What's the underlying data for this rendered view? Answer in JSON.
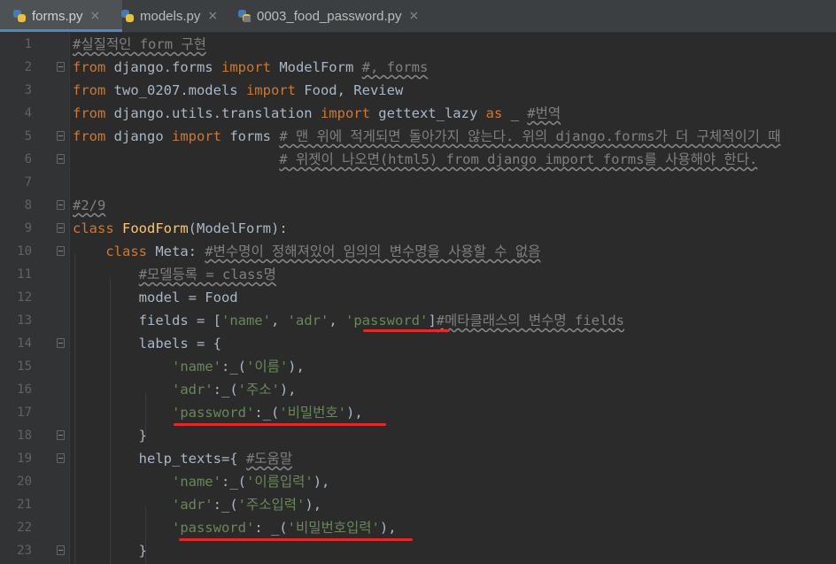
{
  "tabs": [
    {
      "label": "forms.py",
      "active": true
    },
    {
      "label": "models.py",
      "active": false
    },
    {
      "label": "0003_food_password.py",
      "active": false
    }
  ],
  "close_glyph": "×",
  "lines": [
    {
      "n": "1",
      "parts": [
        {
          "t": "#실질적인 form 구현",
          "c": "cmt"
        }
      ]
    },
    {
      "n": "2",
      "parts": [
        {
          "t": "from",
          "c": "kw"
        },
        {
          "t": " django.forms "
        },
        {
          "t": "import",
          "c": "kw"
        },
        {
          "t": " ModelForm "
        },
        {
          "t": "#, forms",
          "c": "cmt"
        }
      ]
    },
    {
      "n": "3",
      "parts": [
        {
          "t": "from",
          "c": "kw"
        },
        {
          "t": " two_0207.models "
        },
        {
          "t": "import",
          "c": "kw"
        },
        {
          "t": " Food, Review"
        }
      ]
    },
    {
      "n": "4",
      "parts": [
        {
          "t": "from",
          "c": "kw"
        },
        {
          "t": " django.utils.translation "
        },
        {
          "t": "import",
          "c": "kw"
        },
        {
          "t": " gettext_lazy "
        },
        {
          "t": "as",
          "c": "kw"
        },
        {
          "t": " _ "
        },
        {
          "t": "#번역",
          "c": "cmt"
        }
      ]
    },
    {
      "n": "5",
      "parts": [
        {
          "t": "from",
          "c": "kw"
        },
        {
          "t": " django "
        },
        {
          "t": "import",
          "c": "kw"
        },
        {
          "t": " forms "
        },
        {
          "t": "# 맨 위에 적게되면 돌아가지 않는다. 위의 django.forms가 더 구체적이기 때",
          "c": "cmt"
        }
      ]
    },
    {
      "n": "6",
      "parts": [
        {
          "t": "                         "
        },
        {
          "t": "# 위젯이 나오면(html5) from django import forms를 사용해야 한다.",
          "c": "cmt"
        }
      ]
    },
    {
      "n": "7",
      "parts": []
    },
    {
      "n": "8",
      "parts": [
        {
          "t": "#2/9",
          "c": "cmt"
        }
      ]
    },
    {
      "n": "9",
      "parts": [
        {
          "t": "class",
          "c": "kw"
        },
        {
          "t": " "
        },
        {
          "t": "FoodForm",
          "c": "cls"
        },
        {
          "t": "(ModelForm):"
        }
      ]
    },
    {
      "n": "10",
      "parts": [
        {
          "t": "    "
        },
        {
          "t": "class",
          "c": "kw"
        },
        {
          "t": " Meta: "
        },
        {
          "t": "#변수명이 정해져있어 임의의 변수명을 사용할 수 없음",
          "c": "cmt"
        }
      ]
    },
    {
      "n": "11",
      "parts": [
        {
          "t": "        "
        },
        {
          "t": "#모델등록 = class명",
          "c": "cmt"
        }
      ]
    },
    {
      "n": "12",
      "parts": [
        {
          "t": "        model = Food"
        }
      ]
    },
    {
      "n": "13",
      "parts": [
        {
          "t": "        fields = ["
        },
        {
          "t": "'name'",
          "c": "str"
        },
        {
          "t": ", "
        },
        {
          "t": "'adr'",
          "c": "str"
        },
        {
          "t": ", "
        },
        {
          "t": "'password'",
          "c": "str"
        },
        {
          "t": "]"
        },
        {
          "t": "#메타클래스의 변수명 fields",
          "c": "cmt"
        }
      ]
    },
    {
      "n": "14",
      "parts": [
        {
          "t": "        labels = {"
        }
      ]
    },
    {
      "n": "15",
      "parts": [
        {
          "t": "            "
        },
        {
          "t": "'name'",
          "c": "str"
        },
        {
          "t": ":_("
        },
        {
          "t": "'이름'",
          "c": "str"
        },
        {
          "t": "),"
        }
      ]
    },
    {
      "n": "16",
      "parts": [
        {
          "t": "            "
        },
        {
          "t": "'adr'",
          "c": "str"
        },
        {
          "t": ":_("
        },
        {
          "t": "'주소'",
          "c": "str"
        },
        {
          "t": "),"
        }
      ]
    },
    {
      "n": "17",
      "parts": [
        {
          "t": "            "
        },
        {
          "t": "'password'",
          "c": "str"
        },
        {
          "t": ":_("
        },
        {
          "t": "'비밀번호'",
          "c": "str"
        },
        {
          "t": "),"
        }
      ]
    },
    {
      "n": "18",
      "parts": [
        {
          "t": "        }"
        }
      ]
    },
    {
      "n": "19",
      "parts": [
        {
          "t": "        help_texts={ "
        },
        {
          "t": "#도움말",
          "c": "cmt"
        }
      ]
    },
    {
      "n": "20",
      "parts": [
        {
          "t": "            "
        },
        {
          "t": "'name'",
          "c": "str"
        },
        {
          "t": ":_("
        },
        {
          "t": "'이름입력'",
          "c": "str"
        },
        {
          "t": "),"
        }
      ]
    },
    {
      "n": "21",
      "parts": [
        {
          "t": "            "
        },
        {
          "t": "'adr'",
          "c": "str"
        },
        {
          "t": ":_("
        },
        {
          "t": "'주소입력'",
          "c": "str"
        },
        {
          "t": "),"
        }
      ]
    },
    {
      "n": "22",
      "parts": [
        {
          "t": "            "
        },
        {
          "t": "'password'",
          "c": "str"
        },
        {
          "t": ": _("
        },
        {
          "t": "'비밀번호입력'",
          "c": "str"
        },
        {
          "t": "),"
        }
      ]
    },
    {
      "n": "23",
      "parts": [
        {
          "t": "        }"
        }
      ]
    }
  ]
}
